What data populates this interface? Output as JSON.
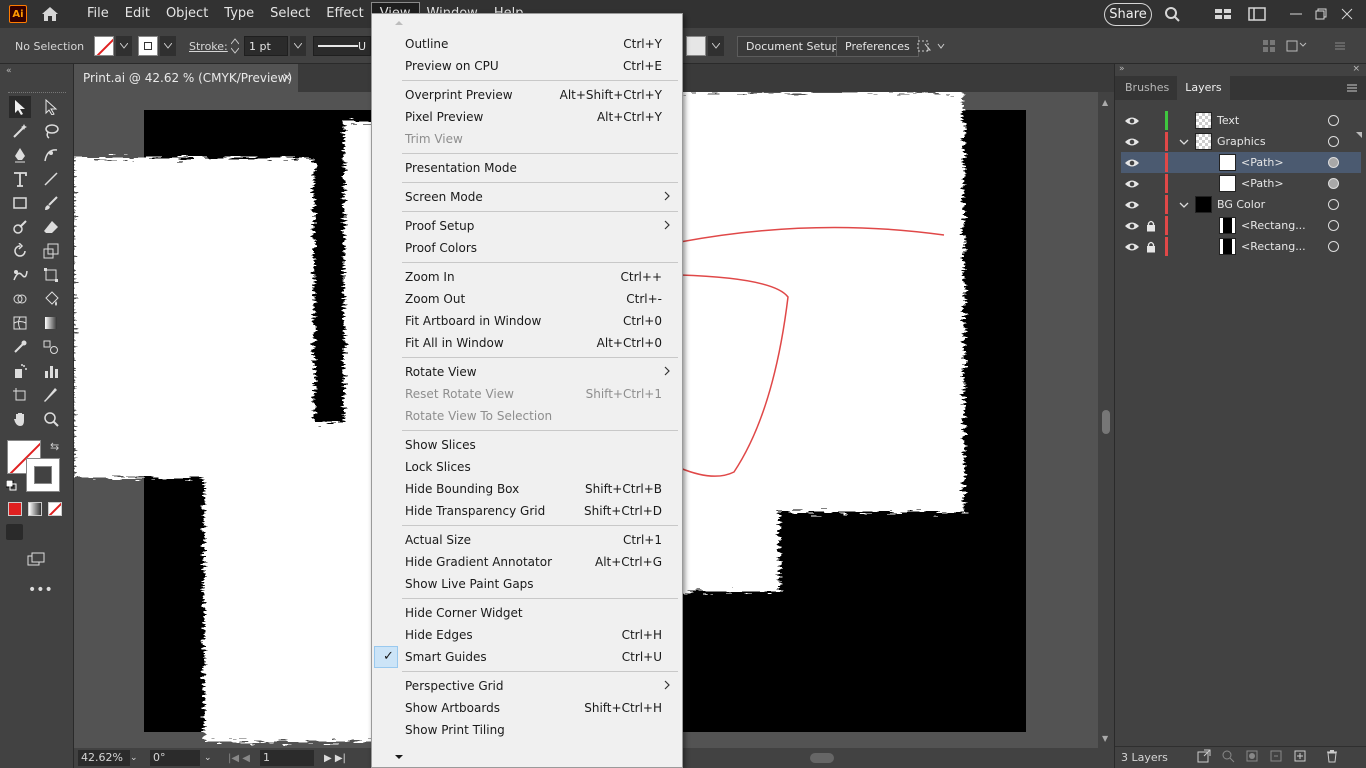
{
  "menubar": {
    "logo": "Ai",
    "items": [
      {
        "label": "File"
      },
      {
        "label": "Edit"
      },
      {
        "label": "Object"
      },
      {
        "label": "Type"
      },
      {
        "label": "Select"
      },
      {
        "label": "Effect"
      },
      {
        "label": "View"
      },
      {
        "label": "Window"
      },
      {
        "label": "Help"
      }
    ],
    "share_label": "Share"
  },
  "controlbar": {
    "selection": "No Selection",
    "stroke_label": "Stroke:",
    "stroke_value": "1 pt",
    "brush_short": "U",
    "document_setup": "Document Setup",
    "preferences": "Preferences"
  },
  "document_tab": {
    "title": "Print.ai @ 42.62 % (CMYK/Preview)",
    "close": "×"
  },
  "statusbar": {
    "zoom": "42.62%",
    "rotation": "0°",
    "artboard": "1"
  },
  "panel": {
    "tabs": [
      {
        "label": "Brushes"
      },
      {
        "label": "Layers"
      }
    ],
    "active_tab": "Layers",
    "layers": [
      {
        "name": "Text",
        "color": "#3fc63f",
        "locked": false,
        "expanded": false,
        "depth": 0,
        "selected": false
      },
      {
        "name": "Graphics",
        "color": "#e04848",
        "locked": false,
        "expanded": true,
        "depth": 0,
        "selected": false
      },
      {
        "name": "<Path>",
        "color": "#e04848",
        "locked": false,
        "expanded": false,
        "depth": 1,
        "selected": true
      },
      {
        "name": "<Path>",
        "color": "#e04848",
        "locked": false,
        "expanded": false,
        "depth": 1,
        "selected": false
      },
      {
        "name": "BG Color",
        "color": "#e04848",
        "locked": false,
        "expanded": true,
        "depth": 0,
        "selected": false
      },
      {
        "name": "<Rectang...",
        "color": "#e04848",
        "locked": true,
        "expanded": false,
        "depth": 1,
        "selected": false
      },
      {
        "name": "<Rectang...",
        "color": "#e04848",
        "locked": true,
        "expanded": false,
        "depth": 1,
        "selected": false
      }
    ],
    "footer_count": "3 Layers"
  },
  "view_menu": {
    "groups": [
      [
        {
          "label": "Outline",
          "shortcut": "Ctrl+Y"
        },
        {
          "label": "Preview on CPU",
          "shortcut": "Ctrl+E"
        }
      ],
      [
        {
          "label": "Overprint Preview",
          "shortcut": "Alt+Shift+Ctrl+Y"
        },
        {
          "label": "Pixel Preview",
          "shortcut": "Alt+Ctrl+Y"
        },
        {
          "label": "Trim View",
          "shortcut": "",
          "disabled": true
        }
      ],
      [
        {
          "label": "Presentation Mode",
          "shortcut": ""
        }
      ],
      [
        {
          "label": "Screen Mode",
          "shortcut": "",
          "submenu": true
        }
      ],
      [
        {
          "label": "Proof Setup",
          "shortcut": "",
          "submenu": true
        },
        {
          "label": "Proof Colors",
          "shortcut": ""
        }
      ],
      [
        {
          "label": "Zoom In",
          "shortcut": "Ctrl++"
        },
        {
          "label": "Zoom Out",
          "shortcut": "Ctrl+-"
        },
        {
          "label": "Fit Artboard in Window",
          "shortcut": "Ctrl+0"
        },
        {
          "label": "Fit All in Window",
          "shortcut": "Alt+Ctrl+0"
        }
      ],
      [
        {
          "label": "Rotate View",
          "shortcut": "",
          "submenu": true
        },
        {
          "label": "Reset Rotate View",
          "shortcut": "Shift+Ctrl+1",
          "disabled": true
        },
        {
          "label": "Rotate View To Selection",
          "shortcut": "",
          "disabled": true
        }
      ],
      [
        {
          "label": "Show Slices",
          "shortcut": ""
        },
        {
          "label": "Lock Slices",
          "shortcut": ""
        },
        {
          "label": "Hide Bounding Box",
          "shortcut": "Shift+Ctrl+B"
        },
        {
          "label": "Hide Transparency Grid",
          "shortcut": "Shift+Ctrl+D"
        }
      ],
      [
        {
          "label": "Actual Size",
          "shortcut": "Ctrl+1"
        },
        {
          "label": "Hide Gradient Annotator",
          "shortcut": "Alt+Ctrl+G"
        },
        {
          "label": "Show Live Paint Gaps",
          "shortcut": ""
        }
      ],
      [
        {
          "label": "Hide Corner Widget",
          "shortcut": ""
        },
        {
          "label": "Hide Edges",
          "shortcut": "Ctrl+H"
        },
        {
          "label": "Smart Guides",
          "shortcut": "Ctrl+U",
          "checked": true
        }
      ],
      [
        {
          "label": "Perspective Grid",
          "shortcut": "",
          "submenu": true
        },
        {
          "label": "Show Artboards",
          "shortcut": "Shift+Ctrl+H"
        },
        {
          "label": "Show Print Tiling",
          "shortcut": ""
        }
      ]
    ]
  },
  "colors": {
    "accent_selected_layer": "#4b5a70",
    "menu_bg": "#f0f0f0",
    "check_highlight": "#cce4f7",
    "path_stroke": "#e04848"
  }
}
